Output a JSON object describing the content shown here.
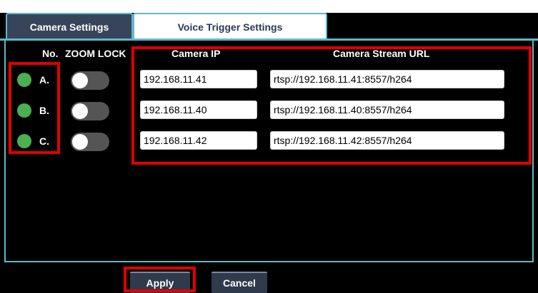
{
  "tabs": [
    {
      "label": "Camera Settings",
      "active": true
    },
    {
      "label": "Voice Trigger Settings",
      "active": false
    }
  ],
  "headers": {
    "no": "No.",
    "zoom_lock": "ZOOM LOCK",
    "camera_ip": "Camera IP",
    "stream_url": "Camera Stream URL"
  },
  "cameras": [
    {
      "letter": "A.",
      "status": "online",
      "zoom_lock": false,
      "ip": "192.168.11.41",
      "url": "rtsp://192.168.11.41:8557/h264"
    },
    {
      "letter": "B.",
      "status": "online",
      "zoom_lock": false,
      "ip": "192.168.11.40",
      "url": "rtsp://192.168.11.40:8557/h264"
    },
    {
      "letter": "C.",
      "status": "online",
      "zoom_lock": false,
      "ip": "192.168.11.42",
      "url": "rtsp://192.168.11.42:8557/h264"
    }
  ],
  "buttons": {
    "apply": "Apply",
    "cancel": "Cancel"
  },
  "colors": {
    "accent": "#5fb8c8",
    "status_online": "#4caf50",
    "highlight": "#e00000"
  }
}
